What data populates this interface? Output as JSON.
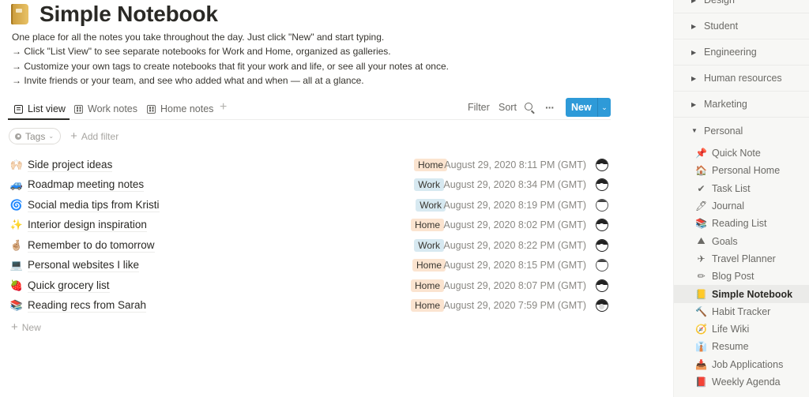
{
  "page": {
    "icon": "notebook-icon",
    "title": "Simple Notebook",
    "description": [
      "One place for all the notes you take throughout the day. Just click \"New\" and start typing.",
      "→ Click \"List View\" to see separate notebooks for Work and Home, organized as galleries.",
      "→ Customize your own tags to create notebooks that fit your work and life, or see all your notes at once.",
      "→ Invite friends or your team, and see who added what and when — all at a glance."
    ]
  },
  "tabs": [
    {
      "label": "List view",
      "icon": "list-view-icon",
      "active": true
    },
    {
      "label": "Work notes",
      "icon": "gallery-icon",
      "active": false
    },
    {
      "label": "Home notes",
      "icon": "gallery-icon",
      "active": false
    }
  ],
  "toolbar": {
    "add_view": "+",
    "filter": "Filter",
    "sort": "Sort",
    "search_icon": "search-icon",
    "more": "···",
    "new": "New",
    "new_chevron": "⌄"
  },
  "filters": {
    "tags_label": "Tags",
    "tags_chevron": "⌄",
    "add_filter": "Add filter",
    "add_plus": "+"
  },
  "notes": [
    {
      "emoji": "🙌🏻",
      "title": "Side project ideas",
      "tag": "Home",
      "date": "August 29, 2020 8:11 PM (GMT)",
      "avatar": "user-avatar"
    },
    {
      "emoji": "🚙",
      "title": "Roadmap meeting notes",
      "tag": "Work",
      "date": "August 29, 2020 8:34 PM (GMT)",
      "avatar": "user-avatar"
    },
    {
      "emoji": "🌀",
      "title": "Social media tips from Kristi",
      "tag": "Work",
      "date": "August 29, 2020 8:19 PM (GMT)",
      "avatar": "user-avatar"
    },
    {
      "emoji": "✨",
      "title": "Interior design inspiration",
      "tag": "Home",
      "date": "August 29, 2020 8:02 PM (GMT)",
      "avatar": "user-avatar"
    },
    {
      "emoji": "🤞🏼",
      "title": "Remember to do tomorrow",
      "tag": "Work",
      "date": "August 29, 2020 8:22 PM (GMT)",
      "avatar": "user-avatar"
    },
    {
      "emoji": "💻",
      "title": "Personal websites I like",
      "tag": "Home",
      "date": "August 29, 2020 8:15 PM (GMT)",
      "avatar": "user-avatar"
    },
    {
      "emoji": "🍓",
      "title": "Quick grocery list",
      "tag": "Home",
      "date": "August 29, 2020 8:07 PM (GMT)",
      "avatar": "user-avatar"
    },
    {
      "emoji": "📚",
      "title": "Reading recs from Sarah",
      "tag": "Home",
      "date": "August 29, 2020 7:59 PM (GMT)",
      "avatar": "user-avatar"
    }
  ],
  "add_new": {
    "plus": "+",
    "label": "New"
  },
  "sidebar": {
    "sections": [
      {
        "label": "Design",
        "expanded": false
      },
      {
        "label": "Student",
        "expanded": false
      },
      {
        "label": "Engineering",
        "expanded": false
      },
      {
        "label": "Human resources",
        "expanded": false
      },
      {
        "label": "Marketing",
        "expanded": false
      },
      {
        "label": "Personal",
        "expanded": true
      }
    ],
    "collapsed_marker": "▶",
    "expanded_marker": "▼",
    "items": [
      {
        "emoji": "📌",
        "label": "Quick Note"
      },
      {
        "emoji": "🏠",
        "label": "Personal Home"
      },
      {
        "emoji": "✔",
        "label": "Task List"
      },
      {
        "emoji": "🖊",
        "label": "Journal"
      },
      {
        "emoji": "📚",
        "label": "Reading List"
      },
      {
        "emoji": "⛰",
        "label": "Goals"
      },
      {
        "emoji": "✈",
        "label": "Travel Planner"
      },
      {
        "emoji": "✏",
        "label": "Blog Post"
      },
      {
        "emoji": "📒",
        "label": "Simple Notebook",
        "active": true
      },
      {
        "emoji": "🔨",
        "label": "Habit Tracker"
      },
      {
        "emoji": "🧭",
        "label": "Life Wiki"
      },
      {
        "emoji": "👔",
        "label": "Resume"
      },
      {
        "emoji": "📥",
        "label": "Job Applications"
      },
      {
        "emoji": "📕",
        "label": "Weekly Agenda"
      }
    ]
  },
  "colors": {
    "accent_blue": "#2e9ad8",
    "tag_home": "#fbe4d0",
    "tag_work": "#d7e9f1",
    "sidebar_bg": "#f7f7f5",
    "text_primary": "#2a2925",
    "text_secondary": "#8a8883"
  }
}
